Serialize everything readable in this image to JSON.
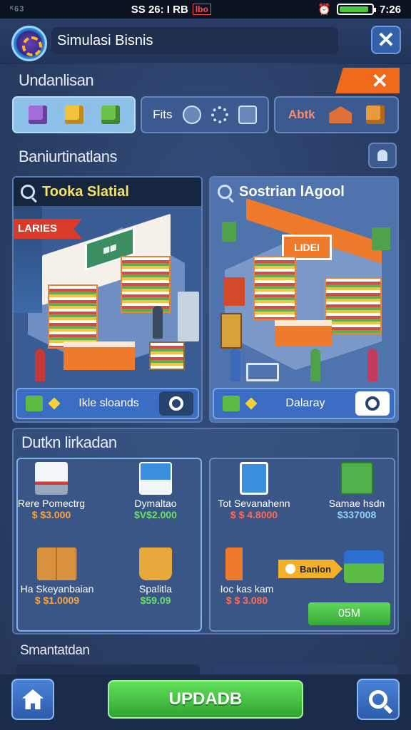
{
  "status": {
    "left": "ᴷ63",
    "time_mid": "SS 26: I RB",
    "badge": "lbo",
    "time_right": "7:26",
    "battery_pct": 90
  },
  "header": {
    "title": "Simulasi Bisnis",
    "close": "✕"
  },
  "categories": {
    "title": "Undanlisan",
    "close": "✕",
    "items": [
      {
        "label": ""
      },
      {
        "label": "Fits"
      },
      {
        "label": "Abtk"
      }
    ]
  },
  "stores": {
    "title": "Baniurtinatlans",
    "cards": [
      {
        "name": "Tooka Slatial",
        "ribbon": "LARIES",
        "footer": "Ikle sloands"
      },
      {
        "name": "Sostrian lAgool",
        "sign": "LIDEI",
        "footer": "Dalaray"
      }
    ]
  },
  "investments": {
    "title": "Dutkn lirkadan",
    "left": [
      {
        "name": "Rere Pomectrg",
        "price": "$ $3.000",
        "color": "o"
      },
      {
        "name": "Dymaltao",
        "price": "$V$2.000",
        "color": "g"
      },
      {
        "name": "Ha Skeyanbaian",
        "price": "$ $1.0009",
        "color": "o"
      },
      {
        "name": "Spalitla",
        "price": "$59.09",
        "color": "g"
      }
    ],
    "right": [
      {
        "name": "Tot Sevanahenn",
        "price": "$ $ 4.8000",
        "color": "r"
      },
      {
        "name": "Samae hsdn",
        "price": "$337008",
        "color": "b"
      },
      {
        "name": "Ioc kas kam",
        "price": "$ $ 3.080",
        "color": "r"
      }
    ],
    "arrow_label": "Banlon",
    "green_button": "05M"
  },
  "summary": {
    "title": "Smantatdan"
  },
  "bottom": {
    "update": "UPDADB"
  },
  "colors": {
    "accent_orange": "#f06a1c",
    "accent_green": "#3fb43c",
    "panel_blue": "#3a5686"
  }
}
